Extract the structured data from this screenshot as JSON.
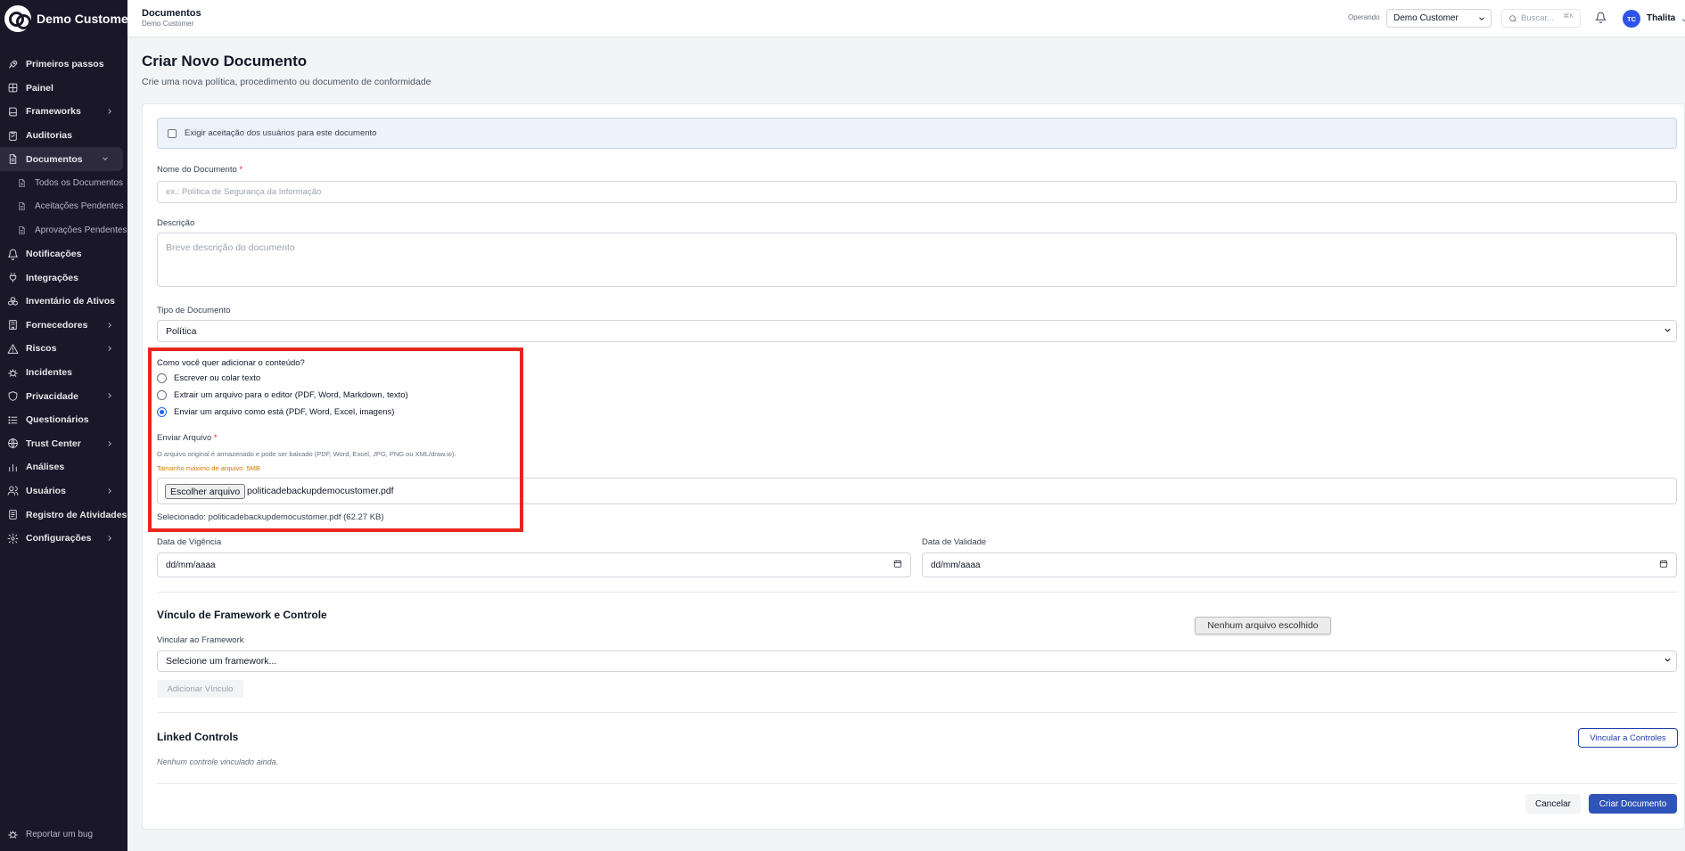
{
  "app": {
    "name": "Demo Customer"
  },
  "sidebar": {
    "items": [
      {
        "label": "Primeiros passos",
        "icon": "rocket-icon"
      },
      {
        "label": "Painel",
        "icon": "grid-icon"
      },
      {
        "label": "Frameworks",
        "icon": "book-icon",
        "expandable": true
      },
      {
        "label": "Auditorias",
        "icon": "clipboard-icon"
      },
      {
        "label": "Documentos",
        "icon": "file-icon",
        "expanded": true,
        "active": true
      },
      {
        "label": "Todos os Documentos",
        "icon": "file-icon",
        "sub": true
      },
      {
        "label": "Aceitações Pendentes",
        "icon": "file-icon",
        "sub": true
      },
      {
        "label": "Aprovações Pendentes",
        "icon": "file-icon",
        "sub": true
      },
      {
        "label": "Notificações",
        "icon": "bell-icon"
      },
      {
        "label": "Integrações",
        "icon": "plug-icon"
      },
      {
        "label": "Inventário de Ativos",
        "icon": "boxes-icon"
      },
      {
        "label": "Fornecedores",
        "icon": "building-icon",
        "expandable": true
      },
      {
        "label": "Riscos",
        "icon": "warning-icon",
        "expandable": true
      },
      {
        "label": "Incidentes",
        "icon": "bug-icon"
      },
      {
        "label": "Privacidade",
        "icon": "shield-icon",
        "expandable": true
      },
      {
        "label": "Questionários",
        "icon": "list-icon"
      },
      {
        "label": "Trust Center",
        "icon": "globe-icon",
        "expandable": true
      },
      {
        "label": "Análises",
        "icon": "bar-chart-icon"
      },
      {
        "label": "Usuários",
        "icon": "users-icon",
        "expandable": true
      },
      {
        "label": "Registro de Atividades",
        "icon": "log-icon"
      },
      {
        "label": "Configurações",
        "icon": "gear-icon",
        "expandable": true
      }
    ],
    "footer": "Reportar um bug"
  },
  "topbar": {
    "title": "Documentos",
    "subtitle": "Demo Customer",
    "operating_label": "Operando",
    "operating_value": "Demo Customer",
    "search_placeholder": "Buscar...",
    "search_shortcut": "⌘K",
    "user_initials": "TC",
    "user_name": "Thalita"
  },
  "page": {
    "title": "Criar Novo Documento",
    "subtitle": "Crie uma nova política, procedimento ou documento de conformidade"
  },
  "form": {
    "require_acceptance": "Exigir aceitação dos usuários para este documento",
    "name_label": "Nome do Documento",
    "name_placeholder": "ex.: Política de Segurança da Informação",
    "description_label": "Descrição",
    "description_placeholder": "Breve descrição do documento",
    "type_label": "Tipo de Documento",
    "type_value": "Política",
    "content_question": "Como você quer adicionar o conteúdo?",
    "content_options": [
      "Escrever ou colar texto",
      "Extrair um arquivo para o editor (PDF, Word, Markdown, texto)",
      "Enviar um arquivo como está (PDF, Word, Excel, imagens)"
    ],
    "selected_option": 2,
    "upload_label": "Enviar Arquivo",
    "upload_help": "O arquivo original é armazenado e pode ser baixado (PDF, Word, Excel, JPG, PNG ou XML/draw.io).",
    "upload_max": "Tamanho máximo de arquivo: 5MB",
    "choose_file": "Escolher arquivo",
    "file_name": "politicadebackupdemocustomer.pdf",
    "selected_file": "Selecionado: politicadebackupdemocustomer.pdf (62.27 KB)",
    "effective_label": "Data de Vigência",
    "effective_value": "dd/mm/aaaa",
    "expiry_label": "Data de Validade",
    "expiry_value": "dd/mm/aaaa",
    "framework_section": "Vínculo de Framework e Controle",
    "framework_label": "Vincular ao Framework",
    "framework_placeholder": "Selecione um framework...",
    "add_link": "Adicionar Vínculo",
    "tooltip": "Nenhum arquivo escolhido",
    "linked_controls": "Linked Controls",
    "link_controls_button": "Vincular a Controles",
    "no_controls": "Nenhum controle vinculado ainda.",
    "cancel": "Cancelar",
    "submit": "Criar Documento"
  },
  "colors": {
    "sidebar_bg": "#1a1729",
    "primary": "#2f54b8",
    "highlight": "#e8261c"
  }
}
